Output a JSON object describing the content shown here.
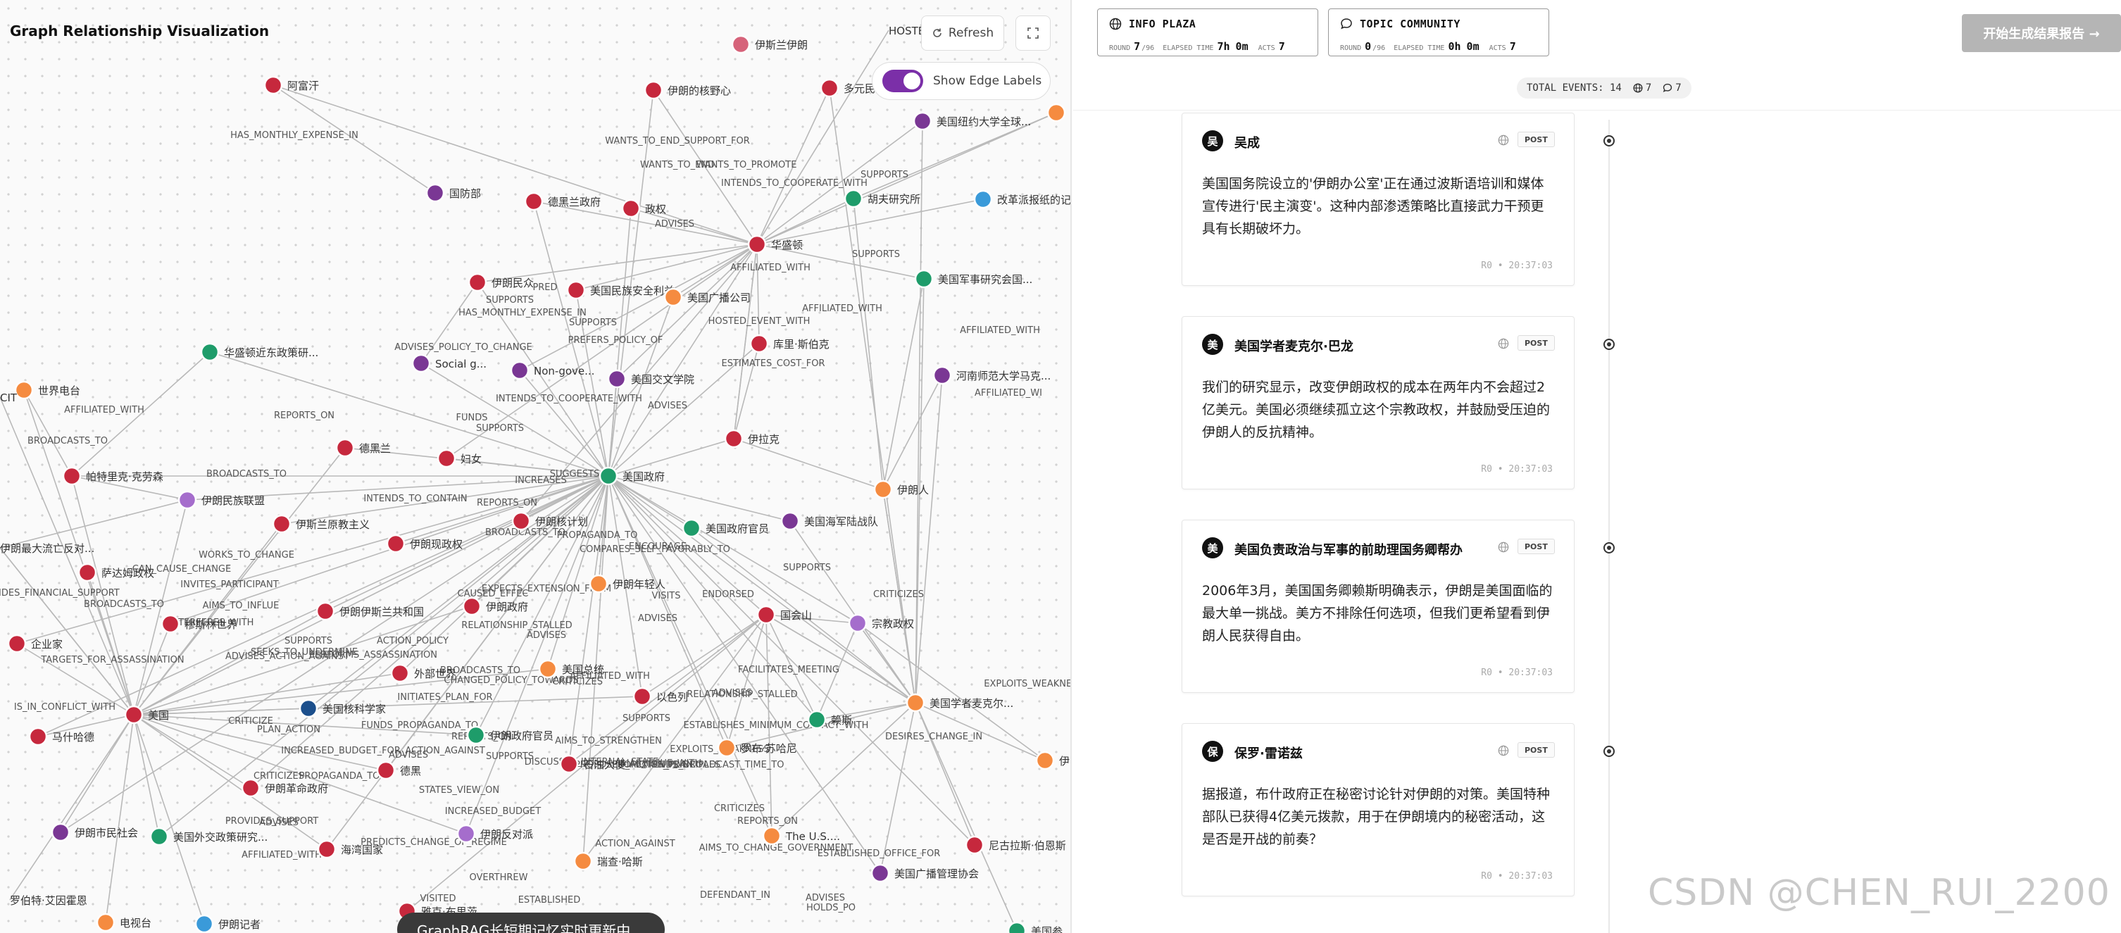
{
  "left_panel": {
    "title": "Graph Relationship Visualization",
    "refresh_label": "Refresh",
    "edge_labels_toggle_label": "Show Edge Labels",
    "edge_labels_on": true,
    "bottom_toast": "GraphRAG长短期记忆实时更新中"
  },
  "graph": {
    "node_colors": {
      "red": "#c6283d",
      "purple": "#7a3794",
      "green": "#1e9c6a",
      "orange": "#f58b40",
      "blue": "#3a9ad9",
      "lilac": "#a56dcc",
      "navy": "#1c4f8c",
      "pink": "#d6637a"
    },
    "nodes": [
      {
        "label": "伊斯兰伊朗",
        "color": "pink"
      },
      {
        "label": "HOSTED_EVENT",
        "color": ""
      },
      {
        "label": "阿富汗",
        "color": "red"
      },
      {
        "label": "伊朗的核野心",
        "color": "red"
      },
      {
        "label": "多元民",
        "color": "red"
      },
      {
        "label": "美国纽约大学全球...",
        "color": "purple"
      },
      {
        "label": "美",
        "color": "orange"
      },
      {
        "label": "国防部",
        "color": "purple"
      },
      {
        "label": "德黑兰政府",
        "color": "red"
      },
      {
        "label": "政权",
        "color": "red"
      },
      {
        "label": "胡夫研究所",
        "color": "green"
      },
      {
        "label": "改革派报纸的记",
        "color": "blue"
      },
      {
        "label": "华盛顿",
        "color": "red"
      },
      {
        "label": "伊朗民众",
        "color": "red"
      },
      {
        "label": "美国民族安全利益",
        "color": "red"
      },
      {
        "label": "美国广播公司",
        "color": "orange"
      },
      {
        "label": "美国军事研究会国...",
        "color": "green"
      },
      {
        "label": "华盛顿近东政策研...",
        "color": "green"
      },
      {
        "label": "Social g...",
        "color": "purple"
      },
      {
        "label": "Non-gove...",
        "color": "purple"
      },
      {
        "label": "美国交文学院",
        "color": "purple"
      },
      {
        "label": "库里·斯伯克",
        "color": "red"
      },
      {
        "label": "河南师范大学马克...",
        "color": "purple"
      },
      {
        "label": "世界电台",
        "color": "orange"
      },
      {
        "label": "CIT",
        "color": ""
      },
      {
        "label": "德黑兰",
        "color": "red"
      },
      {
        "label": "妇女",
        "color": "red"
      },
      {
        "label": "伊拉克",
        "color": "red"
      },
      {
        "label": "帕特里克·克劳森",
        "color": "red"
      },
      {
        "label": "美国政府",
        "color": "green"
      },
      {
        "label": "伊朗人",
        "color": "orange"
      },
      {
        "label": "伊朗民族联盟",
        "color": "lilac"
      },
      {
        "label": "伊斯兰原教主义",
        "color": "red"
      },
      {
        "label": "伊朗核计划",
        "color": "red"
      },
      {
        "label": "美国政府官员",
        "color": "green"
      },
      {
        "label": "美国海军陆战队",
        "color": "purple"
      },
      {
        "label": "伊朗最大流亡反对...",
        "color": ""
      },
      {
        "label": "伊朗现政权",
        "color": "red"
      },
      {
        "label": "萨达姆政权",
        "color": "red"
      },
      {
        "label": "伊朗年轻人",
        "color": "orange"
      },
      {
        "label": "穆斯林世界",
        "color": "red"
      },
      {
        "label": "伊朗伊斯兰共和国",
        "color": "red"
      },
      {
        "label": "伊朗政府",
        "color": "red"
      },
      {
        "label": "国会山",
        "color": "red"
      },
      {
        "label": "宗教政权",
        "color": "lilac"
      },
      {
        "label": "企业家",
        "color": "red"
      },
      {
        "label": "外部世界",
        "color": "red"
      },
      {
        "label": "美国总统",
        "color": "orange"
      },
      {
        "label": "以色列",
        "color": "red"
      },
      {
        "label": "美国学者麦克尔...",
        "color": "orange"
      },
      {
        "label": "美国",
        "color": "red"
      },
      {
        "label": "美国核科学家",
        "color": "navy"
      },
      {
        "label": "赖斯",
        "color": "green"
      },
      {
        "label": "马什哈德",
        "color": "red"
      },
      {
        "label": "伊朗政府官员",
        "color": "green"
      },
      {
        "label": "罗布·苏哈尼",
        "color": "orange"
      },
      {
        "label": "伊",
        "color": "orange"
      },
      {
        "label": "德黑",
        "color": "red"
      },
      {
        "label": "伊朗革命政府",
        "color": "red"
      },
      {
        "label": "石油大使",
        "color": "red"
      },
      {
        "label": "伊朗市民社会",
        "color": "purple"
      },
      {
        "label": "美国外交政策研究...",
        "color": "green"
      },
      {
        "label": "伊朗反对派",
        "color": "lilac"
      },
      {
        "label": "The U.S....",
        "color": "orange"
      },
      {
        "label": "尼古拉斯·伯恩斯",
        "color": "red"
      },
      {
        "label": "海湾国家",
        "color": "red"
      },
      {
        "label": "瑞查·哈斯",
        "color": "orange"
      },
      {
        "label": "美国广播管理协会",
        "color": "purple"
      },
      {
        "label": "罗伯特·艾因霍恩",
        "color": ""
      },
      {
        "label": "电视台",
        "color": "orange"
      },
      {
        "label": "伊朗记者",
        "color": "blue"
      },
      {
        "label": "雅克·布里茨",
        "color": "red"
      },
      {
        "label": "美国参",
        "color": "green"
      }
    ],
    "edge_labels": [
      "HAS_MONTHLY_EXPENSE_IN",
      "WANTS_TO_END_SUPPORT_FOR",
      "WANTS_TO_END",
      "WANTS_TO_PROMOTE",
      "INTENDS_TO_COOPERATE_WITH",
      "SUPPORTS",
      "ADVISES",
      "SUPPORTS",
      "AFFILIATED_WITH",
      "AFFILIATED_WITH",
      "HOSTED_EVENT_WITH",
      "AFFILIATED_WITH",
      "AFFILIATED_WI",
      "PRED",
      "SUPPORTS",
      "HAS_MONTHLY_EXPENSE_IN",
      "SUPPORTS",
      "PREFERS_POLICY_OF",
      "ESTIMATES_COST_FOR",
      "ADVISES_POLICY_TO_CHANGE",
      "INTENDS_TO_COOPERATE_WITH",
      "ADVISES",
      "AFFILIATED_WITH",
      "BROADCASTS_TO",
      "REPORTS_ON",
      "BROADCASTS_TO",
      "FUNDS",
      "SUPPORTS",
      "SUGGESTS",
      "INCREASES",
      "REPORTS_ON",
      "INTENDS_TO_CONTAIN",
      "BROADCASTS_TO",
      "PROPAGANDA_TO",
      "ENCOURAGE",
      "COMPARES_SELF_FAVORABLY_TO",
      "WORKS_TO_CHANGE",
      "CAN_CAUSE_CHANGE",
      "INVITES_PARTICIPANT",
      "PROVIDES_FINANCIAL_SUPPORT",
      "BROADCASTS_TO",
      "AIMS_TO_INFLUE",
      "EXPECTS_EXTENSION_FROM",
      "CAUSED_EFFEC",
      "VISITS",
      "ENDORSED",
      "ADVISES",
      "SUPPORTS",
      "CRITICIZES",
      "INTERFERES_WITH",
      "RELATIONSHIP_STALLED",
      "ADVISES",
      "SUPPORTS",
      "SEEKS_TO_UNDERMINE",
      "PERFORMS_ASSASSINATION",
      "ACTION_POLICY",
      "BROADCASTS_TO",
      "AFFILIATED_WITH",
      "CRITICIZES",
      "FACILITATES_MEETING",
      "TARGETS_FOR_ASSASSINATION",
      "ADVISES_ACTION_AGAINST",
      "CHANGED_POLICY_TOWARDS",
      "ADVISES",
      "RELATIONSHIP_STALLED",
      "INITIATES_PLAN_FOR",
      "SUPPORTS",
      "EXPLOITS_WEAKNESS",
      "CRITICIZE",
      "FUNDS_PROPAGANDA_TO",
      "ESTABLISHES_MINIMUM_CONTACT_WITH",
      "IS_IN_CONFLICT_WITH",
      "PLAN_ACTION",
      "DESIRES_CHANGE_IN",
      "REPORTS_ON",
      "AIMS_TO_STRENGTHEN",
      "EXPLOITS_WEAKNESS",
      "PROMOTES_PRINCIPLES",
      "EXTENDS_BROADCAST_TIME_TO",
      "INCREASED_BUDGET_FOR_ACTION_AGAINST",
      "ADVISES",
      "SUPPORTS",
      "HAS_ISSUE_WITH",
      "CRITICIZES",
      "PROPAGANDA_TO",
      "DISCUSSES_INTERNAL_STATE",
      "PROPOSED_ACTION_PLAN",
      "STATES_VIEW_ON",
      "CRITICIZES",
      "PROVIDES_SUPPORT",
      "ADVISES",
      "INCREASED_BUDGET",
      "ACTION_AGAINST",
      "REPORTS_ON",
      "PREDICTS_CHANGE_OF_REGIME",
      "AIMS_TO_CHANGE_GOVERNMENT",
      "ESTABLISHED_OFFICE_FOR",
      "AFFILIATED_WITH",
      "OVERTHREW",
      "VISITED",
      "ESTABLISHED",
      "DEFENDANT_IN",
      "ADVISES",
      "HOLDS_PO"
    ]
  },
  "right_panel": {
    "info_plaza": {
      "title": "INFO PLAZA",
      "round_label": "ROUND",
      "round_value": "7",
      "round_total": "/96",
      "elapsed_label": "ELAPSED TIME",
      "elapsed_h": "7h",
      "elapsed_m": "0m",
      "acts_label": "ACTS",
      "acts_value": "7"
    },
    "topic_community": {
      "title": "TOPIC COMMUNITY",
      "round_label": "ROUND",
      "round_value": "0",
      "round_total": "/96",
      "elapsed_label": "ELAPSED TIME",
      "elapsed_h": "0h",
      "elapsed_m": "0m",
      "acts_label": "ACTS",
      "acts_value": "7"
    },
    "generate_report_label": "开始生成结果报告 →",
    "summary": {
      "total_label": "TOTAL EVENTS: 14",
      "info_count": "7",
      "topic_count": "7"
    },
    "cards": [
      {
        "avatar": "吴",
        "name": "吴成",
        "tag": "POST",
        "text": "美国国务院设立的'伊朗办公室'正在通过波斯语培训和媒体宣传进行'民主演变'。这种内部渗透策略比直接武力干预更具有长期破坏力。",
        "meta": "R0 • 20:37:03"
      },
      {
        "avatar": "美",
        "name": "美国学者麦克尔·巴龙",
        "tag": "POST",
        "text": "我们的研究显示，改变伊朗政权的成本在两年内不会超过2亿美元。美国必须继续孤立这个宗教政权，并鼓励受压迫的伊朗人的反抗精神。",
        "meta": "R0 • 20:37:03"
      },
      {
        "avatar": "美",
        "name": "美国负责政治与军事的前助理国务卿帮办",
        "tag": "POST",
        "text": "2006年3月，美国国务卿赖斯明确表示，伊朗是美国面临的最大单一挑战。美方不排除任何选项，但我们更希望看到伊朗人民获得自由。",
        "meta": "R0 • 20:37:03"
      },
      {
        "avatar": "保",
        "name": "保罗·雷诺兹",
        "tag": "POST",
        "text": "据报道，布什政府正在秘密讨论针对伊朗的对策。美国特种部队已获得4亿美元拨款，用于在伊朗境内的秘密活动，这是否是开战的前奏？",
        "meta": "R0 • 20:37:03"
      }
    ]
  },
  "watermark": "CSDN @CHEN_RUI_2200"
}
